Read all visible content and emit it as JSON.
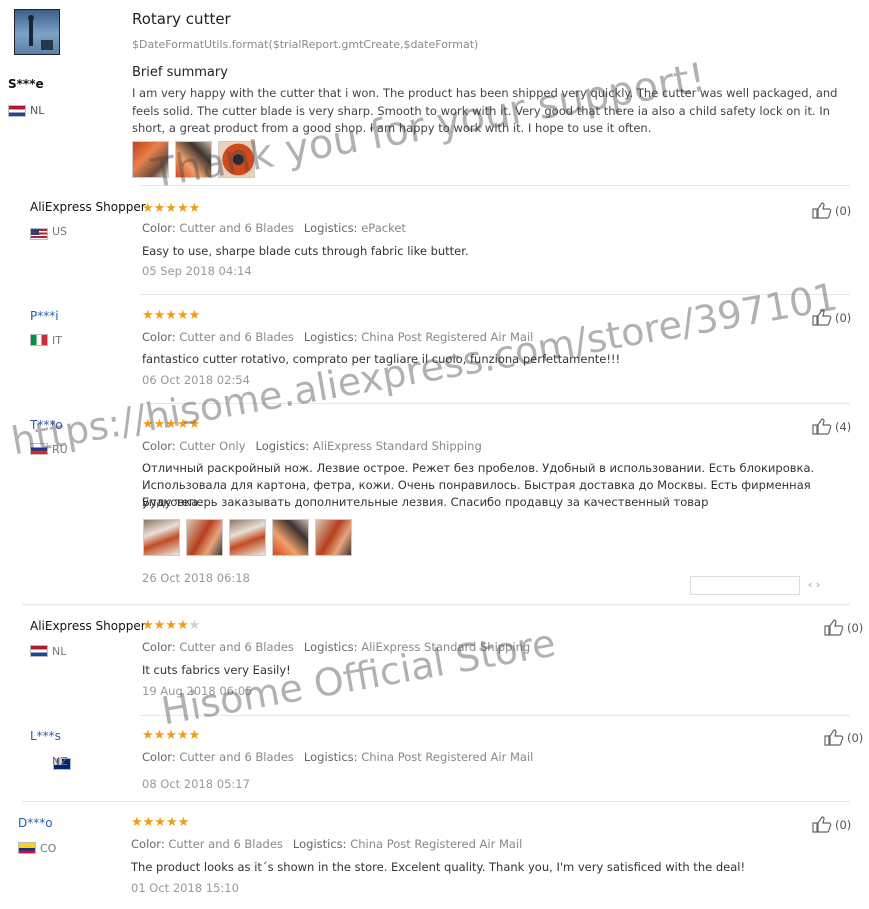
{
  "trial": {
    "product_title": "Rotary cutter",
    "date_template": "$DateFormatUtils.format($trialReport.gmtCreate,$dateFormat)",
    "user": "S***e",
    "country": "NL",
    "summary_heading": "Brief summary",
    "summary_text": "I am very happy with the cutter that i won. The product has been shipped very quickly. The cutter was well packaged, and feels solid. The cutter blade is very sharp. Smooth to work with it. Very good that there ia also a child safety lock on it. In short, a great product from a good shop. I am happy to work with it. I hope to use it often.",
    "photo_count_icons": [
      "photo",
      "photo",
      "photo"
    ]
  },
  "labels": {
    "color": "Color:",
    "logistics": "Logistics:"
  },
  "feedback": [
    {
      "user": "AliExpress Shopper",
      "country": "US",
      "stars": 5,
      "color": "Cutter and 6 Blades",
      "logistics": "ePacket",
      "text": "Easy to use, sharpe blade cuts through fabric like butter.",
      "date": "05 Sep 2018 04:14",
      "likes": "(0)"
    },
    {
      "user": "P***i",
      "country": "IT",
      "stars": 5,
      "color": "Cutter and 6 Blades",
      "logistics": "China Post Registered Air Mail",
      "text": "fantastico cutter rotativo, comprato per tagliare il cuoio, funziona perfettamente!!!",
      "date": "06 Oct 2018 02:54",
      "likes": "(0)"
    },
    {
      "user": "T***o",
      "country": "RU",
      "stars": 5,
      "color": "Cutter Only",
      "logistics": "AliExpress Standard Shipping",
      "text1": "Отличный раскройный нож. Лезвие острое. Режет без пробелов. Удобный в использовании. Есть блокировка.",
      "text2": "Использовала для картона, фетра, кожи. Очень понравилось. Быстрая доставка до Москвы. Есть фирменная упаковка.",
      "text3": "Буду теперь заказывать дополнительные лезвия. Спасибо продавцу за качественный товар",
      "date": "26 Oct 2018 06:18",
      "likes": "(4)"
    },
    {
      "user": "AliExpress Shopper",
      "country": "NL",
      "stars": 4,
      "color": "Cutter and 6 Blades",
      "logistics": "AliExpress Standard Shipping",
      "text": "It cuts fabrics very Easily!",
      "date": "19 Aug 2018 06:05",
      "likes": "(0)"
    },
    {
      "user": "L***s",
      "country": "NZ",
      "stars": 5,
      "color": "Cutter and 6 Blades",
      "logistics": "China Post Registered Air Mail",
      "text": "",
      "date": "08 Oct 2018 05:17",
      "likes": "(0)"
    },
    {
      "user": "D***o",
      "country": "CO",
      "stars": 5,
      "color": "Cutter and 6 Blades",
      "logistics": "China Post Registered Air Mail",
      "text": "The product looks as it´s shown in the store. Excelent quality. Thank you, I'm very satisficed with the deal!",
      "date": "01 Oct 2018 15:10",
      "likes": "(0)"
    }
  ],
  "watermarks": {
    "line1": "Thank you for your support!",
    "line2": "https://hisome.aliexpress.com/store/397101",
    "line3": "Hisome Official Store"
  },
  "colors": {
    "star": "#f39c12",
    "link_user": "#2b5ea8"
  }
}
